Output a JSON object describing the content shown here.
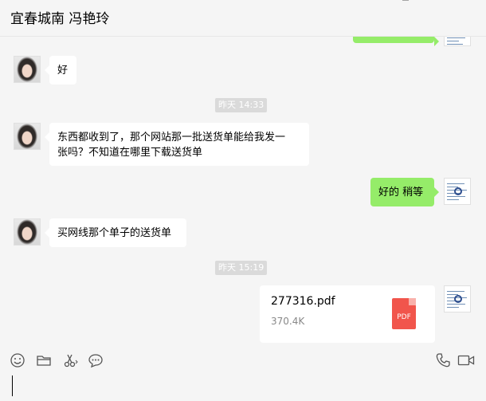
{
  "header": {
    "title": "宜春城南 冯艳玲",
    "controls": [
      "pin-icon",
      "minimize-icon",
      "maximize-icon",
      "close-icon"
    ]
  },
  "messages": [
    {
      "from": "peer",
      "text": "好"
    },
    {
      "timestamp": "昨天 14:33"
    },
    {
      "from": "peer",
      "lines": [
        "东西都收到了，那个网站那一批送货单能给我发一",
        "张吗？不知道在哪里下载送货单"
      ]
    },
    {
      "from": "me",
      "text": "好的 稍等"
    },
    {
      "from": "peer",
      "text": "买网线那个单子的送货单"
    },
    {
      "timestamp": "昨天 15:19"
    },
    {
      "from": "me",
      "file": {
        "name": "277316.pdf",
        "size": "370.4K",
        "type": "PDF"
      }
    }
  ],
  "colors": {
    "background": "#f5f5f5",
    "outgoing_bubble": "#95ec69",
    "incoming_bubble": "#ffffff",
    "timestamp_bg": "#dadada",
    "pdf_icon": "#f1554c"
  },
  "toolbar": {
    "left_icons": [
      "emoji-icon",
      "folder-icon",
      "scissors-icon",
      "chat-bubble-icon"
    ],
    "right_icons": [
      "phone-icon",
      "video-icon"
    ]
  },
  "input": {
    "value": ""
  }
}
